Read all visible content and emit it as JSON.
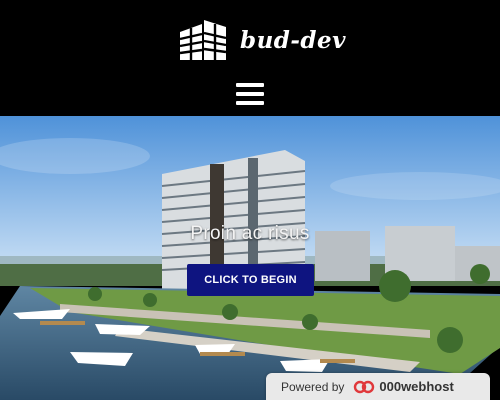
{
  "header": {
    "brand_name": "bud-dev",
    "logo_icon": "buildings-logo-icon",
    "menu_icon": "hamburger-menu-icon"
  },
  "hero": {
    "title": "Proin ac risus",
    "cta_label": "CLICK TO BEGIN",
    "cta_color": "#0e1480"
  },
  "badge": {
    "label": "Powered by",
    "host": "000webhost",
    "logo_color": "#e0383b"
  }
}
